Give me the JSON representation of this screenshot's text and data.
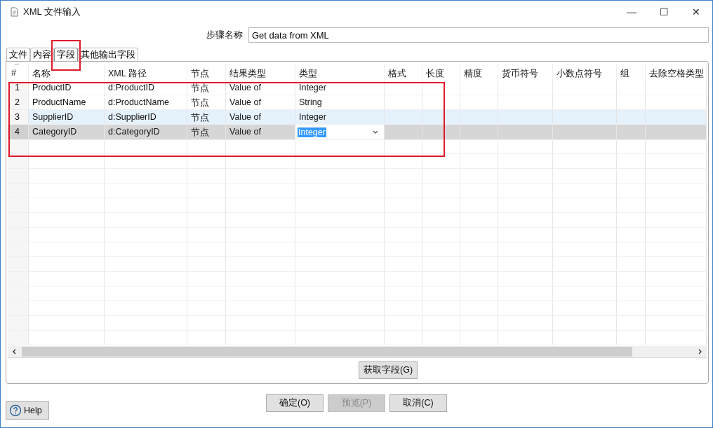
{
  "window": {
    "title": "XML 文件输入",
    "controls": [
      "—",
      "☐",
      "✕"
    ]
  },
  "step_name": {
    "label": "步骤名称",
    "value": "Get data from XML"
  },
  "tabs": [
    {
      "label": "文件",
      "selected": false
    },
    {
      "label": "内容",
      "selected": false
    },
    {
      "label": "字段",
      "selected": true
    },
    {
      "label": "其他输出字段",
      "selected": false
    }
  ],
  "table": {
    "sort_indicator": "^",
    "columns": [
      "#",
      "名称",
      "XML 路径",
      "节点",
      "结果类型",
      "类型",
      "格式",
      "长度",
      "精度",
      "货币符号",
      "小数点符号",
      "组",
      "去除空格类型"
    ],
    "rows": [
      {
        "cells": [
          "1",
          "ProductID",
          "d:ProductID",
          "节点",
          "Value of",
          "Integer"
        ],
        "selected": false,
        "hovered": false,
        "editing": false
      },
      {
        "cells": [
          "2",
          "ProductName",
          "d:ProductName",
          "节点",
          "Value of",
          "String"
        ],
        "selected": false,
        "hovered": false,
        "editing": false
      },
      {
        "cells": [
          "3",
          "SupplierID",
          "d:SupplierID",
          "节点",
          "Value of",
          "Integer"
        ],
        "selected": false,
        "hovered": true,
        "editing": false
      },
      {
        "cells": [
          "4",
          "CategoryID",
          "d:CategoryID",
          "节点",
          "Value of",
          "Integer"
        ],
        "selected": true,
        "hovered": false,
        "editing": true
      }
    ]
  },
  "get_fields_button": "获取字段(G)",
  "buttons": [
    {
      "label": "确定(O)",
      "disabled": false
    },
    {
      "label": "预览(P)",
      "disabled": true
    },
    {
      "label": "取消(C)",
      "disabled": false
    }
  ],
  "help_button": "Help"
}
